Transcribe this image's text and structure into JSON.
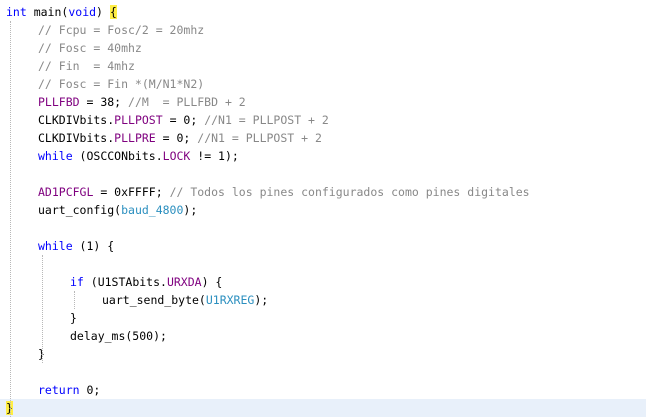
{
  "code": {
    "lines": [
      {
        "indent": 0,
        "current": false,
        "tokens": [
          {
            "t": "int",
            "k": "kw"
          },
          {
            "t": " main",
            "k": "tx"
          },
          {
            "t": "(",
            "k": "tx"
          },
          {
            "t": "void",
            "k": "kw"
          },
          {
            "t": ") ",
            "k": "tx"
          },
          {
            "t": "{",
            "k": "br"
          }
        ]
      },
      {
        "indent": 1,
        "current": false,
        "tokens": [
          {
            "t": "// Fcpu = Fosc/2 = 20mhz",
            "k": "cm"
          }
        ]
      },
      {
        "indent": 1,
        "current": false,
        "tokens": [
          {
            "t": "// Fosc = 40mhz",
            "k": "cm"
          }
        ]
      },
      {
        "indent": 1,
        "current": false,
        "tokens": [
          {
            "t": "// Fin  = 4mhz",
            "k": "cm"
          }
        ]
      },
      {
        "indent": 1,
        "current": false,
        "tokens": [
          {
            "t": "// Fosc = Fin *(M/N1*N2)",
            "k": "cm"
          }
        ]
      },
      {
        "indent": 1,
        "current": false,
        "tokens": [
          {
            "t": "PLLFBD",
            "k": "reg"
          },
          {
            "t": " = 38; ",
            "k": "tx"
          },
          {
            "t": "//M  = PLLFBD + 2",
            "k": "cm"
          }
        ]
      },
      {
        "indent": 1,
        "current": false,
        "tokens": [
          {
            "t": "CLKDIVbits.",
            "k": "tx"
          },
          {
            "t": "PLLPOST",
            "k": "fld"
          },
          {
            "t": " = 0; ",
            "k": "tx"
          },
          {
            "t": "//N1 = PLLPOST + 2",
            "k": "cm"
          }
        ]
      },
      {
        "indent": 1,
        "current": false,
        "tokens": [
          {
            "t": "CLKDIVbits.",
            "k": "tx"
          },
          {
            "t": "PLLPRE",
            "k": "fld"
          },
          {
            "t": " = 0; ",
            "k": "tx"
          },
          {
            "t": "//N1 = PLLPOST + 2",
            "k": "cm"
          }
        ]
      },
      {
        "indent": 1,
        "current": false,
        "tokens": [
          {
            "t": "while",
            "k": "kw"
          },
          {
            "t": " (OSCCONbits.",
            "k": "tx"
          },
          {
            "t": "LOCK",
            "k": "fld"
          },
          {
            "t": " != 1);",
            "k": "tx"
          }
        ]
      },
      {
        "indent": 0,
        "current": false,
        "tokens": []
      },
      {
        "indent": 1,
        "current": false,
        "tokens": [
          {
            "t": "AD1PCFGL",
            "k": "reg"
          },
          {
            "t": " = 0xFFFF; ",
            "k": "tx"
          },
          {
            "t": "// Todos los pines configurados como pines digitales",
            "k": "cm"
          }
        ]
      },
      {
        "indent": 1,
        "current": false,
        "tokens": [
          {
            "t": "uart_config(",
            "k": "tx"
          },
          {
            "t": "baud_4800",
            "k": "mac"
          },
          {
            "t": ");",
            "k": "tx"
          }
        ]
      },
      {
        "indent": 0,
        "current": false,
        "tokens": []
      },
      {
        "indent": 1,
        "current": false,
        "tokens": [
          {
            "t": "while",
            "k": "kw"
          },
          {
            "t": " (1) {",
            "k": "tx"
          }
        ]
      },
      {
        "indent": 0,
        "current": false,
        "tokens": []
      },
      {
        "indent": 2,
        "current": false,
        "tokens": [
          {
            "t": "if",
            "k": "kw"
          },
          {
            "t": " (U1STAbits.",
            "k": "tx"
          },
          {
            "t": "URXDA",
            "k": "fld"
          },
          {
            "t": ") {",
            "k": "tx"
          }
        ]
      },
      {
        "indent": 3,
        "current": false,
        "tokens": [
          {
            "t": "uart_send_byte(",
            "k": "tx"
          },
          {
            "t": "U1RXREG",
            "k": "mac"
          },
          {
            "t": ");",
            "k": "tx"
          }
        ]
      },
      {
        "indent": 2,
        "current": false,
        "tokens": [
          {
            "t": "}",
            "k": "tx"
          }
        ]
      },
      {
        "indent": 2,
        "current": false,
        "tokens": [
          {
            "t": "delay_ms(500);",
            "k": "tx"
          }
        ]
      },
      {
        "indent": 1,
        "current": false,
        "tokens": [
          {
            "t": "}",
            "k": "tx"
          }
        ]
      },
      {
        "indent": 0,
        "current": false,
        "tokens": []
      },
      {
        "indent": 1,
        "current": false,
        "tokens": [
          {
            "t": "return",
            "k": "kw"
          },
          {
            "t": " 0;",
            "k": "tx"
          }
        ]
      },
      {
        "indent": 0,
        "current": true,
        "tokens": [
          {
            "t": "}",
            "k": "br"
          }
        ]
      }
    ]
  },
  "colors": {
    "keyword": "#0000ff",
    "comment": "#888888",
    "register": "#7f007f",
    "macro": "#2b8fbf",
    "brace_match": "#ffee44",
    "current_line": "#e8f0fa"
  }
}
